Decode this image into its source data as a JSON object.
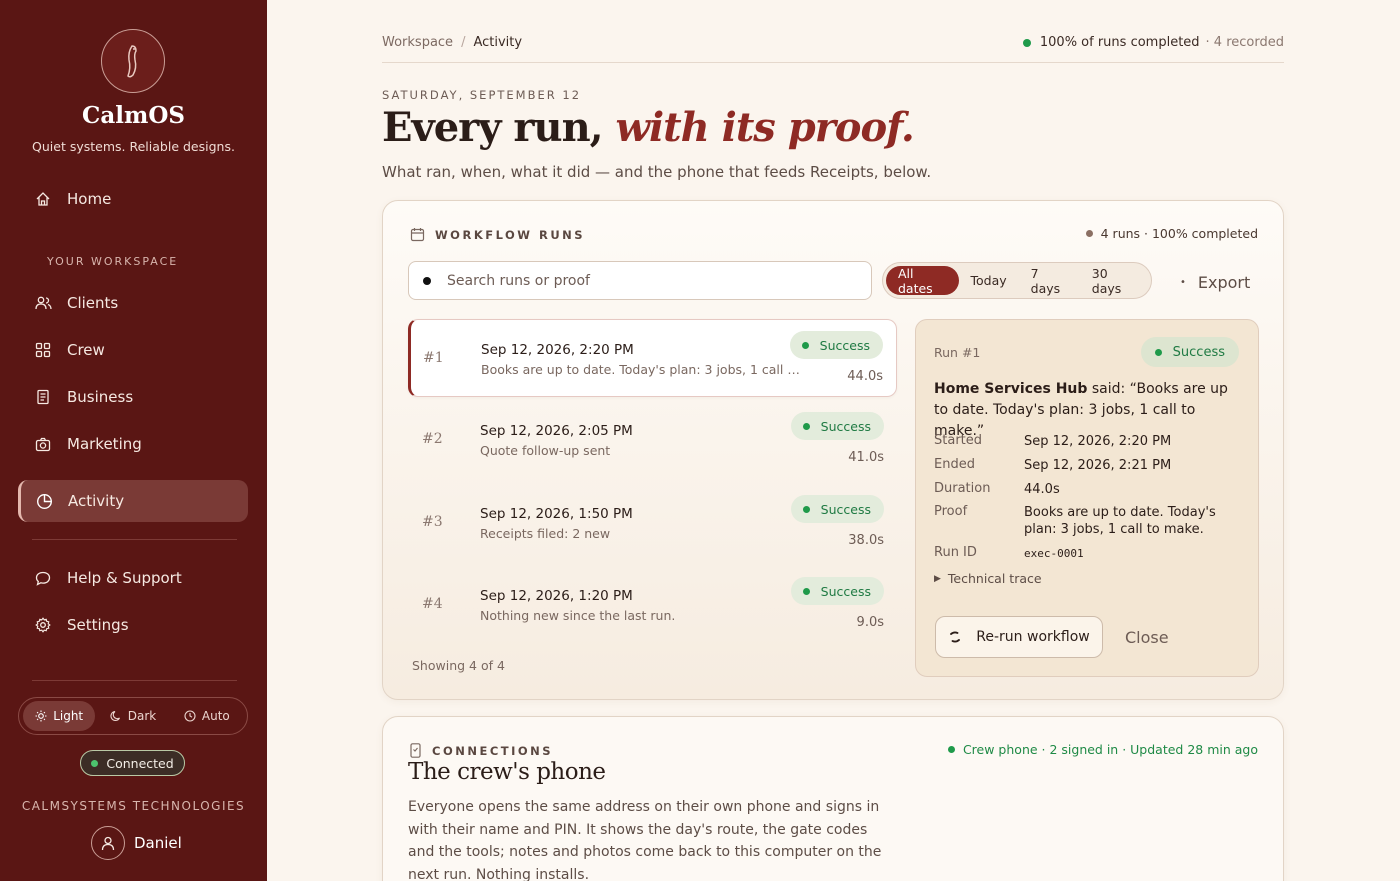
{
  "sidebar": {
    "brand": "CalmOS",
    "tagline": "Quiet systems. Reliable designs.",
    "home": "Home",
    "section_label": "YOUR WORKSPACE",
    "items": [
      {
        "label": "Clients",
        "icon": "users-icon"
      },
      {
        "label": "Crew",
        "icon": "grid-icon"
      },
      {
        "label": "Business",
        "icon": "document-icon"
      },
      {
        "label": "Marketing",
        "icon": "camera-icon"
      },
      {
        "label": "Activity",
        "icon": "pie-chart-icon",
        "active": true
      }
    ],
    "help": "Help & Support",
    "settings": "Settings",
    "theme": {
      "light": "Light",
      "dark": "Dark",
      "auto": "Auto",
      "selected": "Light"
    },
    "connection": "Connected",
    "company": "CALMSYSTEMS TECHNOLOGIES",
    "user": "Daniel"
  },
  "header": {
    "breadcrumb": [
      "Workspace",
      "Activity"
    ],
    "status": "100% of runs completed",
    "status_extra": "· 4 recorded",
    "date": "SATURDAY, SEPTEMBER 12",
    "headline_plain": "Every run, ",
    "headline_em": "with its proof.",
    "subhead": "What ran, when, what it did — and the phone that feeds Receipts, below."
  },
  "runs": {
    "title": "WORKFLOW RUNS",
    "summary": "4 runs · 100% completed",
    "search_placeholder": "Search runs or proof",
    "filters": [
      "All dates",
      "Today",
      "7 days",
      "30 days"
    ],
    "active_filter": "All dates",
    "export": "Export",
    "items": [
      {
        "num": "#1",
        "date": "Sep 12, 2026, 2:20 PM",
        "desc": "Books are up to date. Today's plan: 3 jobs, 1 call to …",
        "status": "Success",
        "duration": "44.0s"
      },
      {
        "num": "#2",
        "date": "Sep 12, 2026, 2:05 PM",
        "desc": "Quote follow-up sent",
        "status": "Success",
        "duration": "41.0s"
      },
      {
        "num": "#3",
        "date": "Sep 12, 2026, 1:50 PM",
        "desc": "Receipts filed: 2 new",
        "status": "Success",
        "duration": "38.0s"
      },
      {
        "num": "#4",
        "date": "Sep 12, 2026, 1:20 PM",
        "desc": "Nothing new since the last run.",
        "status": "Success",
        "duration": "9.0s"
      }
    ],
    "showing": "Showing 4 of 4"
  },
  "detail": {
    "run_label": "Run #1",
    "status": "Success",
    "source": "Home Services Hub",
    "said": " said: “Books are up to date. Today's plan: 3 jobs, 1 call to make.”",
    "started_label": "Started",
    "started": "Sep 12, 2026, 2:20 PM",
    "ended_label": "Ended",
    "ended": "Sep 12, 2026, 2:21 PM",
    "duration_label": "Duration",
    "duration": "44.0s",
    "proof_label": "Proof",
    "proof": "Books are up to date. Today's plan: 3 jobs, 1 call to make.",
    "runid_label": "Run ID",
    "runid": "exec-0001",
    "trace": "Technical trace",
    "rerun": "Re-run workflow",
    "close": "Close"
  },
  "connections": {
    "label": "CONNECTIONS",
    "title": "The crew's phone",
    "status": "Crew phone · 2 signed in · Updated 28 min ago",
    "body": "Everyone opens the same address on their own phone and signs in with their name and PIN. It shows the day's route, the gate codes and the tools; notes and photos come back to this computer on the next run. Nothing installs."
  },
  "colors": {
    "sidebar": "#5a1614",
    "accent": "#8e2a24",
    "success": "#1f9a4a",
    "background": "#fbf5ee"
  }
}
